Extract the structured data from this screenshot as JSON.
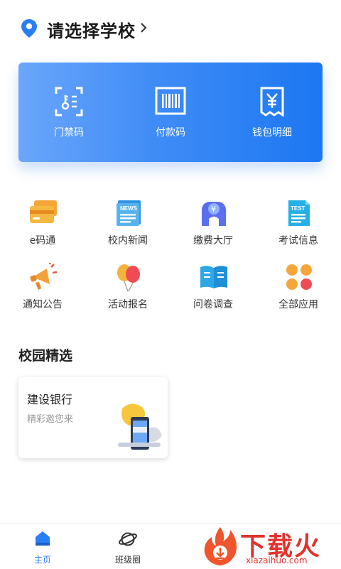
{
  "header": {
    "school_selector": "请选择学校"
  },
  "banner": {
    "items": [
      {
        "label": "门禁码",
        "icon": "access-code-icon"
      },
      {
        "label": "付款码",
        "icon": "barcode-icon"
      },
      {
        "label": "钱包明细",
        "icon": "wallet-receipt-icon"
      }
    ],
    "accent": "#1c77f2"
  },
  "apps": [
    {
      "label": "e码通",
      "icon": "card-icon"
    },
    {
      "label": "校内新闻",
      "icon": "news-icon"
    },
    {
      "label": "缴费大厅",
      "icon": "payment-hall-icon"
    },
    {
      "label": "考试信息",
      "icon": "test-icon"
    },
    {
      "label": "通知公告",
      "icon": "megaphone-icon"
    },
    {
      "label": "活动报名",
      "icon": "balloon-icon"
    },
    {
      "label": "问卷调查",
      "icon": "book-icon"
    },
    {
      "label": "全部应用",
      "icon": "all-apps-icon"
    }
  ],
  "featured": {
    "title": "校园精选",
    "card": {
      "title": "建设银行",
      "subtitle": "精彩邀您来"
    }
  },
  "tabbar": {
    "tabs": [
      {
        "label": "主页",
        "icon": "home-icon",
        "active": true
      },
      {
        "label": "班级圈",
        "icon": "planet-icon",
        "active": false
      }
    ]
  },
  "watermark": {
    "text": "下载火",
    "url": "xiazaihuo.com"
  }
}
